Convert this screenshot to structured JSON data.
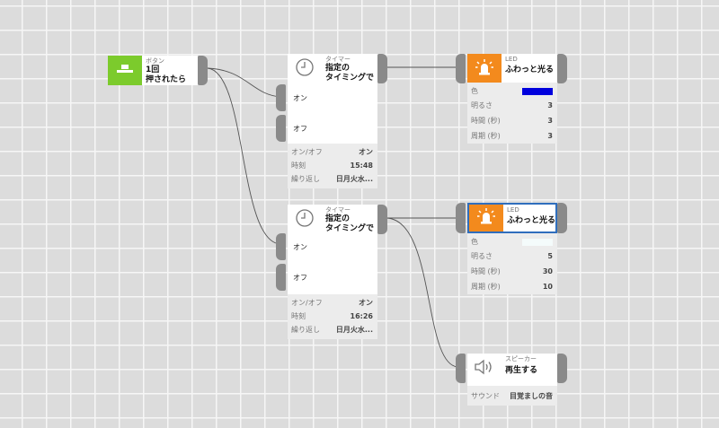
{
  "colors": {
    "button_green": "#7ccb2c",
    "led_orange": "#f38a1d",
    "wire": "#555555",
    "port": "#8a8a8a",
    "selection": "#2f6ebd",
    "led1_color": "#0000dd",
    "led2_color": "#f4fbfb"
  },
  "button_node": {
    "category": "ボタン",
    "name": "1回\n押されたら",
    "icon": "push-button-icon"
  },
  "timer1": {
    "category": "タイマー",
    "name": "指定の\nタイミングで",
    "icon": "clock-icon",
    "input_on": "オン",
    "input_off": "オフ",
    "props": [
      {
        "label": "オン/オフ",
        "value": "オン"
      },
      {
        "label": "時刻",
        "value": "15:48"
      },
      {
        "label": "繰り返し",
        "value": "日月火水..."
      }
    ]
  },
  "timer2": {
    "category": "タイマー",
    "name": "指定の\nタイミングで",
    "icon": "clock-icon",
    "input_on": "オン",
    "input_off": "オフ",
    "props": [
      {
        "label": "オン/オフ",
        "value": "オン"
      },
      {
        "label": "時刻",
        "value": "16:26"
      },
      {
        "label": "繰り返し",
        "value": "日月火水..."
      }
    ]
  },
  "led1": {
    "category": "LED",
    "name": "ふわっと光る",
    "icon": "led-light-icon",
    "color_label": "色",
    "props": [
      {
        "label": "明るさ",
        "value": "3"
      },
      {
        "label": "時間 (秒)",
        "value": "3"
      },
      {
        "label": "周期 (秒)",
        "value": "3"
      }
    ]
  },
  "led2": {
    "category": "LED",
    "name": "ふわっと光る",
    "icon": "led-light-icon",
    "color_label": "色",
    "props": [
      {
        "label": "明るさ",
        "value": "5"
      },
      {
        "label": "時間 (秒)",
        "value": "30"
      },
      {
        "label": "周期 (秒)",
        "value": "10"
      }
    ]
  },
  "speaker": {
    "category": "スピーカー",
    "name": "再生する",
    "icon": "speaker-icon",
    "props": [
      {
        "label": "サウンド",
        "value": "目覚ましの音"
      }
    ]
  }
}
